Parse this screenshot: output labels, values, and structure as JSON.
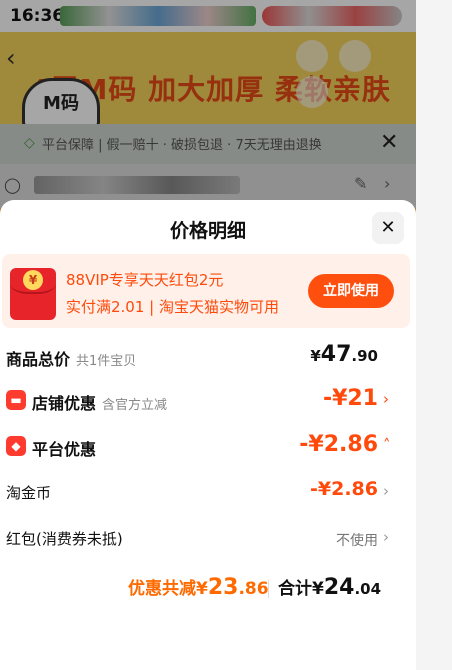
{
  "status_bar": {
    "time": "16:36"
  },
  "background": {
    "banner_text": "4层M码  加大加厚  柔软亲肤",
    "badge_text": "M码",
    "guarantee_text": "平台保障 | 假一赔十 · 破损包退 · 7天无理由退换"
  },
  "sheet": {
    "title": "价格明细",
    "promo": {
      "line1": "88VIP专享天天红包2元",
      "line2": "实付满2.01 | 淘宝天猫实物可用",
      "button": "立即使用",
      "coin": "¥"
    },
    "rows": {
      "goods_total": {
        "label": "商品总价",
        "sub": "共1件宝贝",
        "currency": "¥",
        "int": "47",
        "dec": ".90"
      },
      "shop_discount": {
        "label": "店铺优惠",
        "sub": "含官方立减",
        "price": "-¥21"
      },
      "platform_discount": {
        "label": "平台优惠",
        "price": "-¥2.86"
      },
      "taojinbi": {
        "label": "淘金币",
        "price": "-¥2.86"
      },
      "red_packet": {
        "label": "红包(消费券未抵)",
        "value": "不使用"
      }
    },
    "summary": {
      "saved_label": "优惠共减",
      "saved_currency": "¥",
      "saved_int": "23",
      "saved_dec": ".86",
      "total_label": "合计",
      "total_currency": "¥",
      "total_int": "24",
      "total_dec": ".04"
    }
  },
  "colors": {
    "accent": "#ff4f0e",
    "discount_red": "#ff4a0c",
    "saved_orange": "#ff6a00",
    "promo_bg": "#fff1ea"
  }
}
